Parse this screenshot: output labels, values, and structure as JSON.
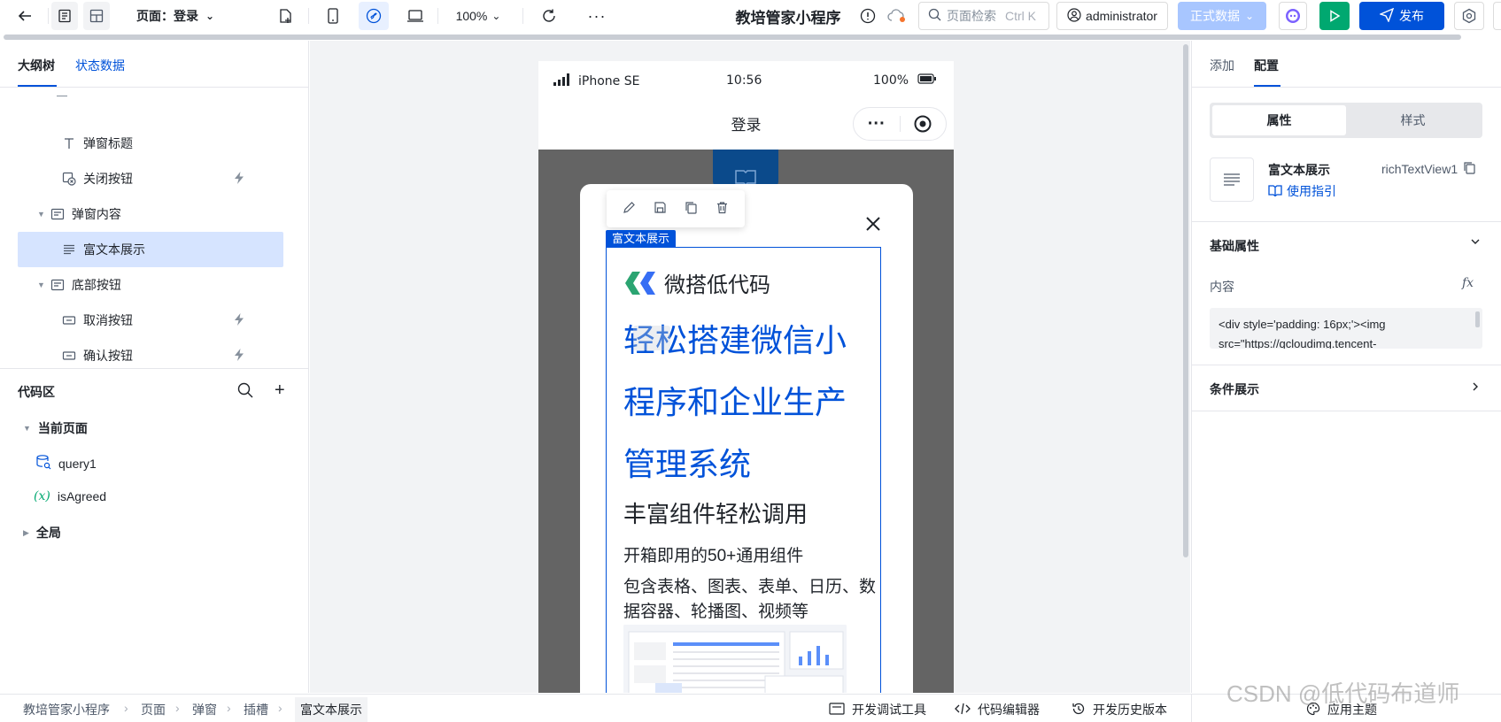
{
  "toolbar": {
    "page_label": "页面：登录",
    "zoom": "100%",
    "app_title": "教培管家小程序",
    "search_placeholder": "页面检索",
    "search_shortcut": "Ctrl K",
    "user": "administrator",
    "data_env": "正式数据",
    "publish": "发布"
  },
  "left": {
    "tabs": [
      "大纲树",
      "状态数据"
    ],
    "tree": [
      {
        "label": "弹窗标题",
        "icon": "text-icon",
        "bolt": false
      },
      {
        "label": "关闭按钮",
        "icon": "close-button-icon",
        "bolt": true
      },
      {
        "label": "弹窗内容",
        "icon": "container-icon",
        "bolt": false
      },
      {
        "label": "富文本展示",
        "icon": "richtext-icon",
        "bolt": false
      },
      {
        "label": "底部按钮",
        "icon": "container-icon",
        "bolt": false
      },
      {
        "label": "取消按钮",
        "icon": "button-icon",
        "bolt": true
      },
      {
        "label": "确认按钮",
        "icon": "button-icon",
        "bolt": true
      }
    ],
    "code_title": "代码区",
    "current_page": "当前页面",
    "query": "query1",
    "variable": "isAgreed",
    "global": "全局"
  },
  "phone": {
    "carrier": "iPhone SE",
    "time": "10:56",
    "battery": "100%",
    "page_title": "登录",
    "selection_label": "富文本展示",
    "brand": "微搭低代码",
    "headline_1": "轻松搭建微信小",
    "headline_2": "程序和企业生产",
    "headline_3": "管理系统",
    "sub": "丰富组件轻松调用",
    "text_1": "开箱即用的50+通用组件",
    "text_2": "包含表格、图表、表单、日历、数",
    "text_3": "据容器、轮播图、视频等"
  },
  "right": {
    "tabs": [
      "添加",
      "配置"
    ],
    "segments": [
      "属性",
      "样式"
    ],
    "component_name": "富文本展示",
    "component_id": "richTextView1",
    "guide_link": "使用指引",
    "section_basic": "基础属性",
    "content_label": "内容",
    "fx": "fx",
    "code_line_1": "<div style='padding: 16px;'><img",
    "code_line_2": "src=\"https://qcloudimg.tencent-",
    "section_condition": "条件展示"
  },
  "status": {
    "breadcrumbs": [
      "教培管家小程序",
      "页面",
      "弹窗",
      "插槽",
      "富文本展示"
    ],
    "debug": "开发调试工具",
    "code_editor": "代码编辑器",
    "history": "开发历史版本",
    "theme": "应用主题"
  },
  "watermark": "CSDN @低代码布道师",
  "colors": {
    "accent": "#0052d9",
    "run": "#00a870",
    "selection_bg": "#d6e4ff",
    "mask": "#646464"
  }
}
